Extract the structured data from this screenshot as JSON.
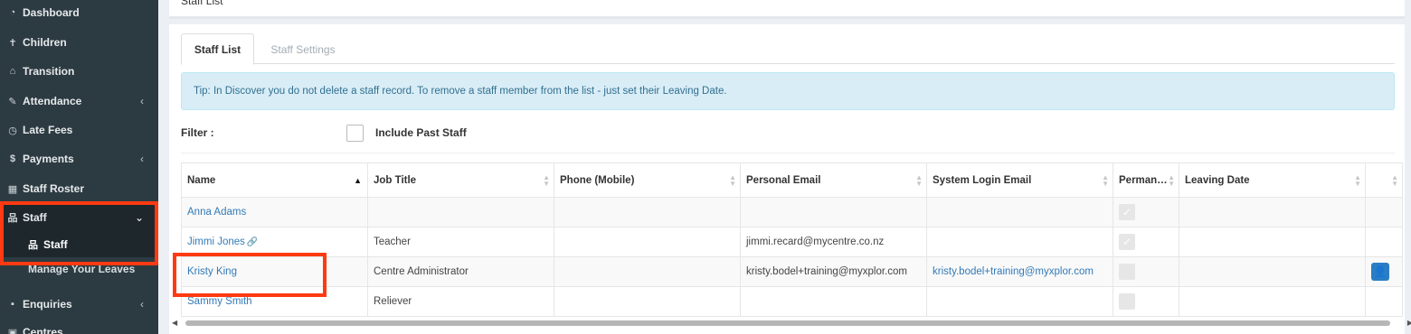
{
  "sidebar": {
    "items": [
      {
        "label": "Dashboard",
        "icon": "dashboard-icon"
      },
      {
        "label": "Children",
        "icon": "child-icon"
      },
      {
        "label": "Transition",
        "icon": "graduation-cap-icon"
      },
      {
        "label": "Attendance",
        "icon": "edit-icon"
      },
      {
        "label": "Late Fees",
        "icon": "clock-icon"
      },
      {
        "label": "Payments",
        "icon": "dollar-icon"
      },
      {
        "label": "Staff Roster",
        "icon": "calendar-icon"
      },
      {
        "label": "Staff",
        "icon": "sitemap-icon"
      },
      {
        "label": "Enquiries",
        "icon": "th-large-icon"
      },
      {
        "label": "Centres",
        "icon": "building-icon"
      }
    ],
    "staff_sub": {
      "staff": "Staff",
      "leaves": "Manage Your Leaves"
    }
  },
  "page": {
    "title": "Staff List"
  },
  "tabs": {
    "staff_list": "Staff List",
    "staff_settings": "Staff Settings"
  },
  "tip": "Tip: In Discover you do not delete a staff record. To remove a staff member from the list - just set their Leaving Date.",
  "filter": {
    "label": "Filter :",
    "include_past": "Include Past Staff"
  },
  "table": {
    "headers": [
      "Name",
      "Job Title",
      "Phone (Mobile)",
      "Personal Email",
      "System Login Email",
      "Perman…",
      "Leaving Date",
      ""
    ],
    "rows": [
      {
        "name": "Anna Adams",
        "job": "",
        "phone": "",
        "personal_email": "",
        "login_email": "",
        "permanent": true,
        "leaving": ""
      },
      {
        "name": "Jimmi Jones",
        "job": "Teacher",
        "phone": "",
        "personal_email": "jimmi.recard@mycentre.co.nz",
        "login_email": "",
        "permanent": true,
        "leaving": ""
      },
      {
        "name": "Kristy King",
        "job": "Centre Administrator",
        "phone": "",
        "personal_email": "kristy.bodel+training@myxplor.com",
        "login_email": "kristy.bodel+training@myxplor.com",
        "permanent": false,
        "leaving": ""
      },
      {
        "name": "Sammy Smith",
        "job": "Reliever",
        "phone": "",
        "personal_email": "",
        "login_email": "",
        "permanent": false,
        "leaving": ""
      }
    ]
  },
  "colors": {
    "sidebar_bg": "#2c3b41",
    "highlight": "#ff3a12",
    "link": "#337ab7",
    "tip_bg": "#d9edf7"
  }
}
